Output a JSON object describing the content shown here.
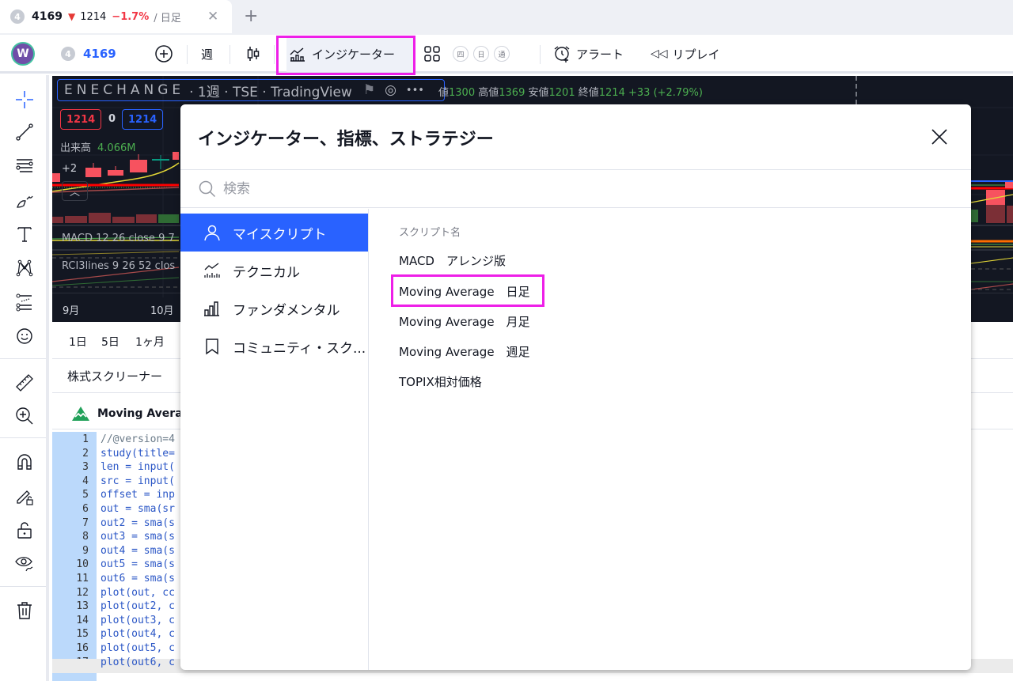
{
  "browser_tab": {
    "badge": "4",
    "symbol": "4169",
    "direction_icon": "triangle-down-icon",
    "price": "1214",
    "change": "−1.7%",
    "timeframe": "/ 日足",
    "close_icon": "close-icon",
    "new_tab_icon": "plus-icon"
  },
  "toolbar": {
    "avatar_letter": "W",
    "symbol_badge": "4",
    "symbol": "4169",
    "interval": "週",
    "indicators_label": "インジケーター",
    "layout_icon": "grid-icon",
    "mini_buttons": [
      "四",
      "日",
      "通"
    ],
    "alert_label": "アラート",
    "replay_label": "リプレイ",
    "colors": {
      "symbol": "#2962ff",
      "highlight": "#ee1fe8"
    }
  },
  "chart": {
    "title_name": "ENECHANGE",
    "title_rest": "· 1週 · TSE · TradingView",
    "ohlc": {
      "open_label": "値",
      "open": "1300",
      "high_label": "高値",
      "high": "1369",
      "low_label": "安値",
      "low": "1201",
      "close_label": "終値",
      "close": "1214",
      "change": "+33 (+2.79%)"
    },
    "sell_price": "1214",
    "spread": "0",
    "buy_price": "1214",
    "volume_label": "出来高",
    "volume": "4.066M",
    "hidden_count": "+2",
    "macd_label": "MACD 12 26 close 9  7",
    "rci_label": "RCI3lines 9 26 52 clos",
    "x_ticks": [
      "9月",
      "10月"
    ]
  },
  "range_bar": {
    "ranges": [
      "1日",
      "5日",
      "1ヶ月"
    ]
  },
  "screener": {
    "label": "株式スクリーナー"
  },
  "editor": {
    "title": "Moving Averag",
    "lines": [
      "//@version=4",
      "study(title=",
      "len = input(",
      "src = input(",
      "offset = inp",
      "out = sma(sr",
      "out2 = sma(s",
      "out3 = sma(s",
      "out4 = sma(s",
      "out5 = sma(s",
      "out6 = sma(s",
      "plot(out, cc",
      "plot(out2, c",
      "plot(out3, c",
      "plot(out4, c",
      "plot(out5, c",
      "plot(out6, c"
    ],
    "current_line": 17
  },
  "modal": {
    "title": "インジケーター、指標、ストラテジー",
    "search_placeholder": "検索",
    "search_value": "",
    "categories": [
      {
        "label": "マイスクリプト",
        "icon": "user-icon",
        "active": true
      },
      {
        "label": "テクニカル",
        "icon": "technical-chart-icon",
        "active": false
      },
      {
        "label": "ファンダメンタル",
        "icon": "bar-chart-icon",
        "active": false
      },
      {
        "label": "コミュニティ・スク...",
        "icon": "bookmark-icon",
        "active": false
      }
    ],
    "list_header": "スクリプト名",
    "scripts": [
      "MACD　アレンジ版",
      "Moving Average　日足",
      "Moving Average　月足",
      "Moving Average　週足",
      "TOPIX相対価格"
    ],
    "highlighted_script_index": 1
  }
}
